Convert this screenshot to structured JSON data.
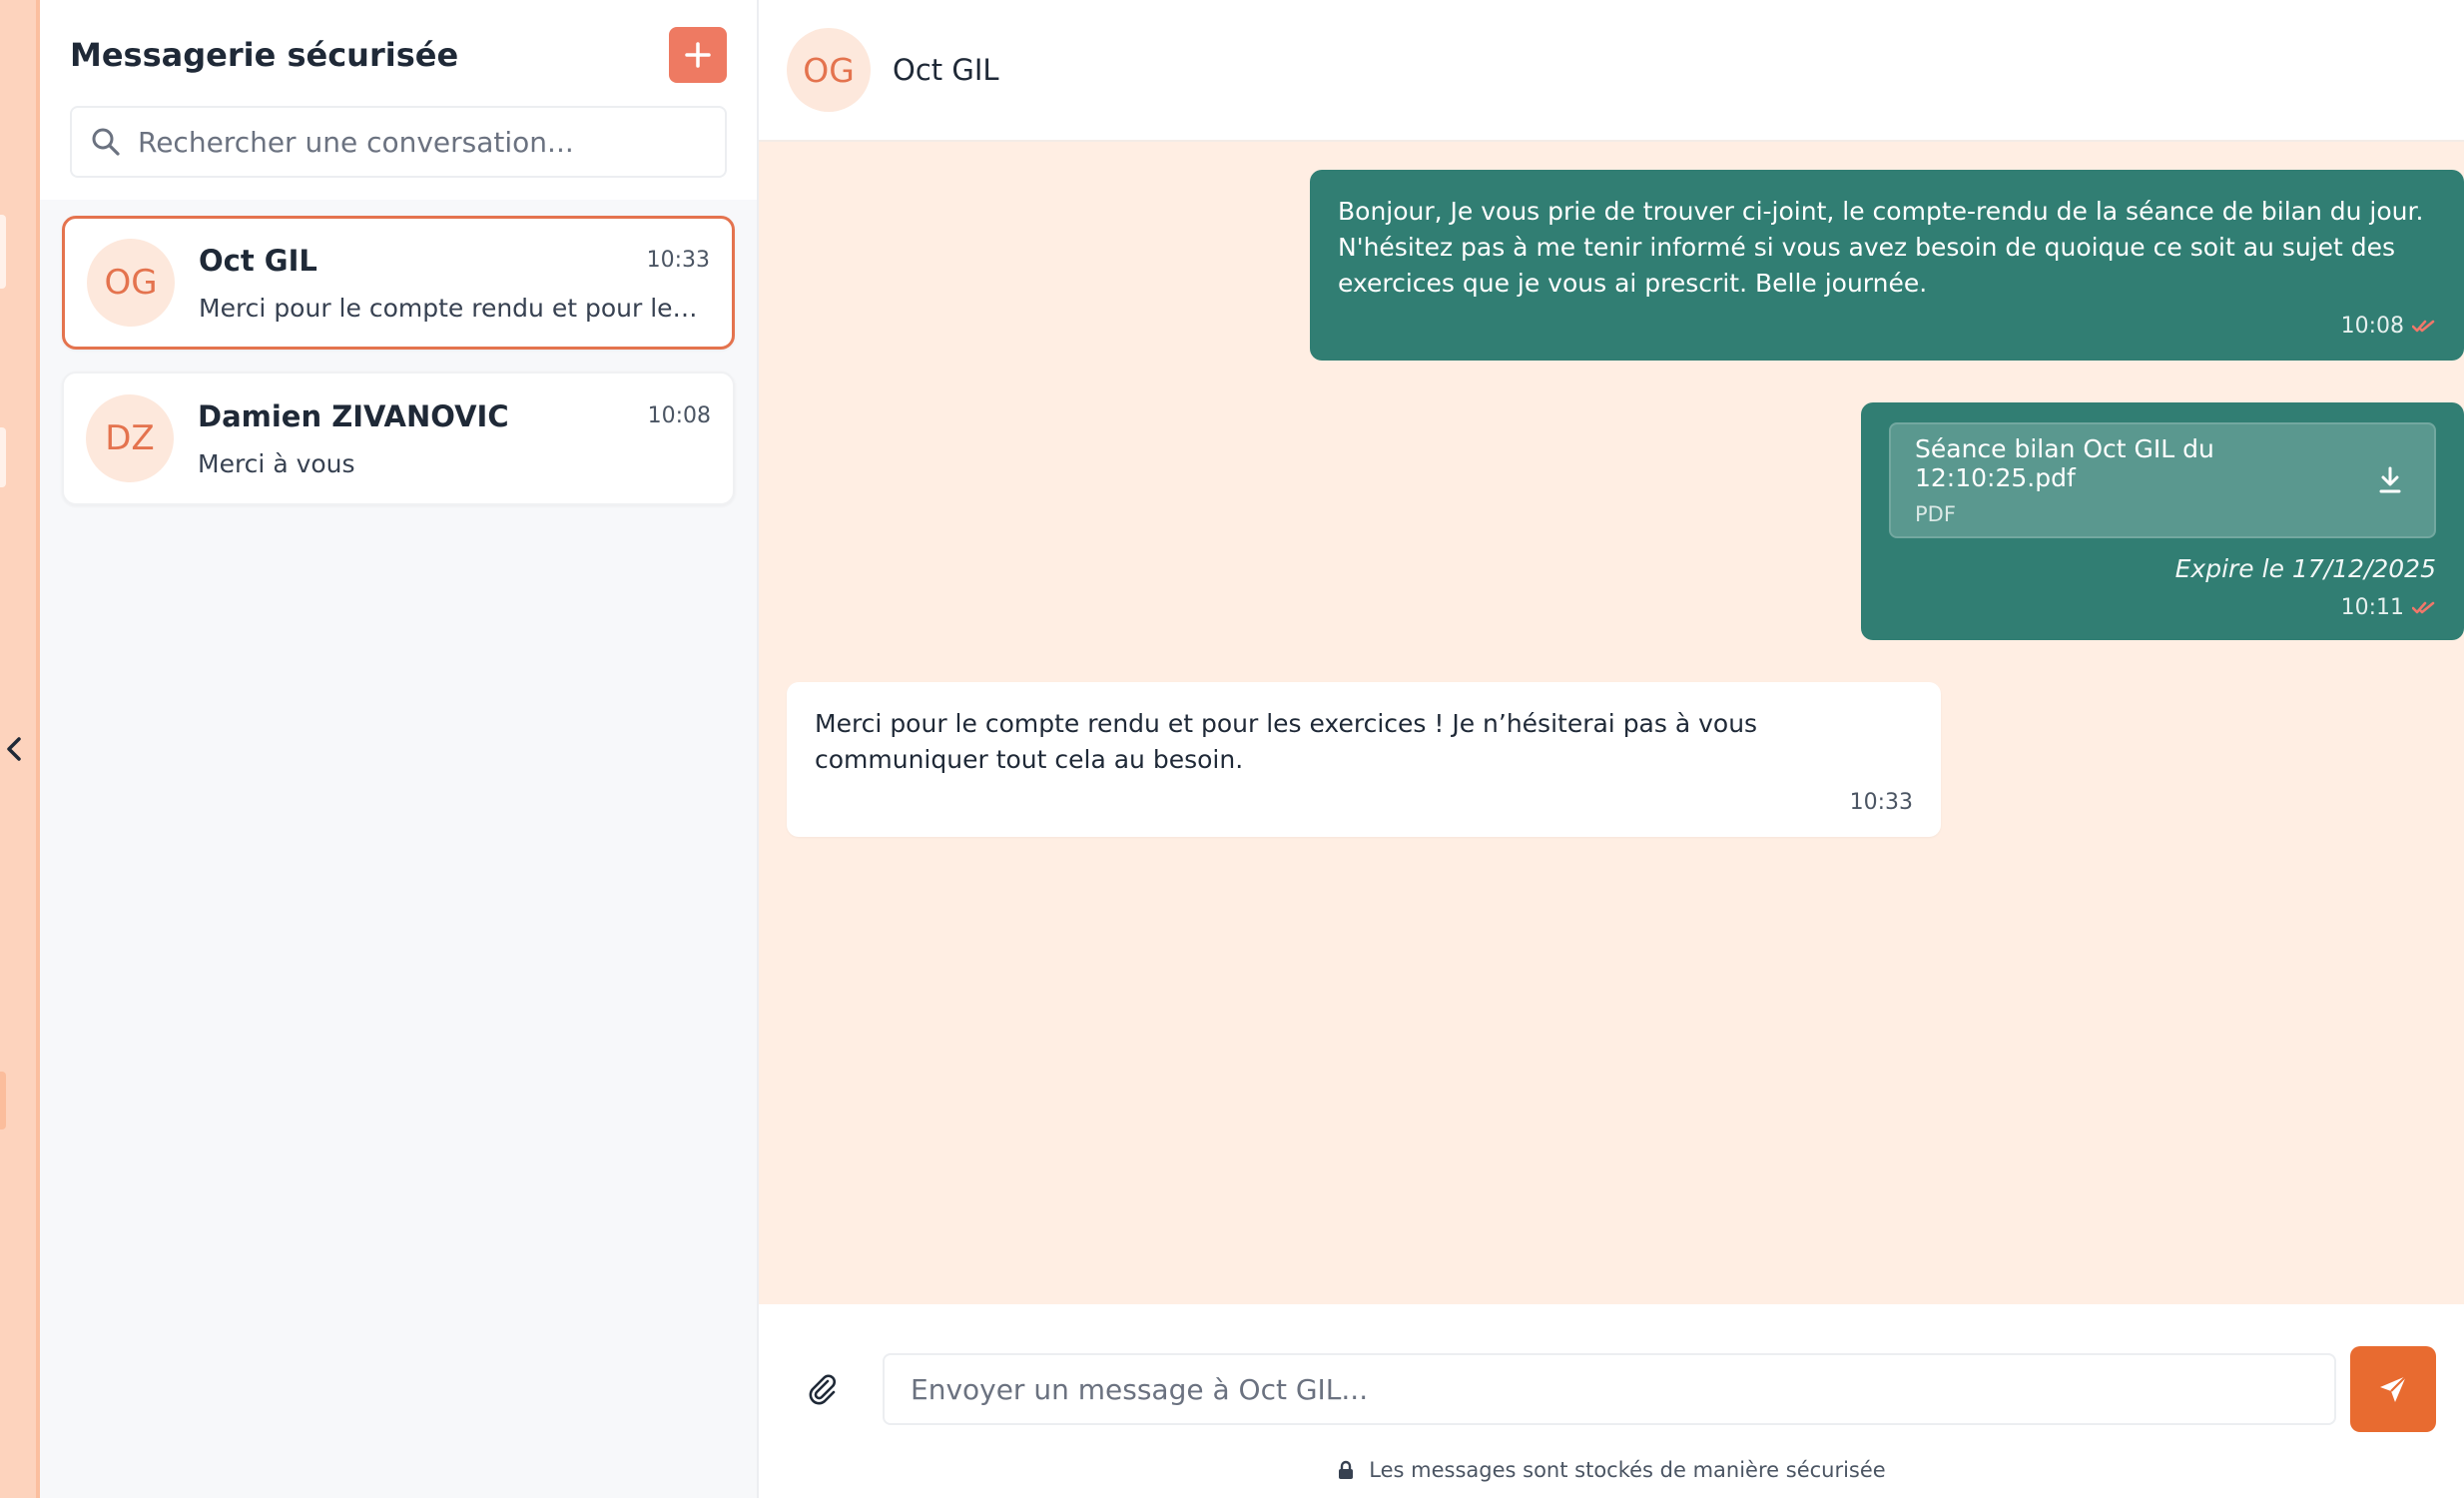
{
  "sidebar": {
    "title": "Messagerie sécurisée",
    "new_button_icon": "plus-icon",
    "search": {
      "placeholder": "Rechercher une conversation...",
      "value": ""
    },
    "conversations": [
      {
        "initials": "OG",
        "name": "Oct GIL",
        "time": "10:33",
        "preview": "Merci pour le compte rendu et pour les exercices ! Je n'hésiterai pas à vous communiquer tout cela au besoin.",
        "active": true
      },
      {
        "initials": "DZ",
        "name": "Damien ZIVANOVIC",
        "time": "10:08",
        "preview": "Merci à vous",
        "active": false
      }
    ]
  },
  "chat": {
    "header": {
      "initials": "OG",
      "name": "Oct GIL"
    },
    "messages": [
      {
        "direction": "out",
        "text": "Bonjour, Je vous prie de trouver ci-joint, le compte-rendu de la séance de bilan du jour. N'hésitez pas à me tenir informé si vous avez besoin de quoique ce soit au sujet des exercices que je vous ai prescrit. Belle journée.",
        "time": "10:08",
        "read": true
      },
      {
        "direction": "out",
        "file": {
          "name": "Séance bilan Oct GIL du 12:10:25.pdf",
          "type": "PDF"
        },
        "expire": "Expire le 17/12/2025",
        "time": "10:11",
        "read": true
      },
      {
        "direction": "in",
        "text": "Merci pour le compte rendu et pour les exercices ! Je n’hésiterai pas à vous communiquer tout cela au besoin.",
        "time": "10:33"
      }
    ],
    "composer": {
      "placeholder": "Envoyer un message à Oct GIL...",
      "value": "",
      "secure_note": "Les messages sont stockés de manière sécurisée"
    }
  },
  "colors": {
    "accent": "#e4734e",
    "outgoing_bubble": "#317e73",
    "chat_background": "#ffeee3",
    "send_button": "#e86b30",
    "read_check": "#f0776a"
  }
}
